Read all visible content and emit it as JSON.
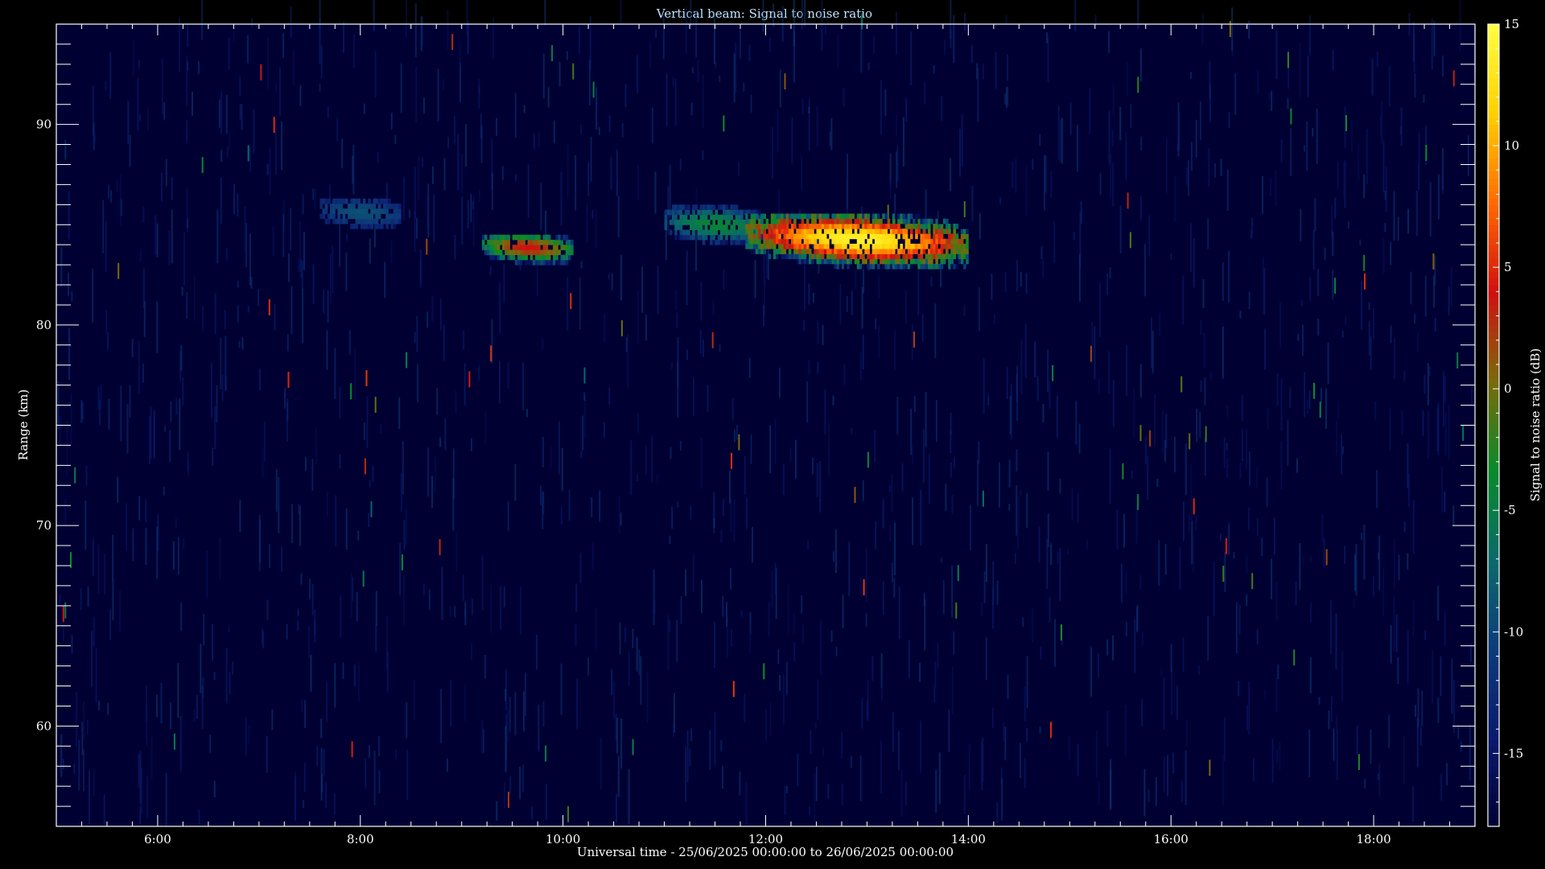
{
  "chart_data": {
    "type": "heatmap",
    "title": "Vertical beam: Signal to noise ratio",
    "xlabel": "Universal time - 25/06/2025 00:00:00 to 26/06/2025 00:00:00",
    "ylabel": "Range (km)",
    "colorbar_label": "Signal to noise ratio (dB)",
    "x_range_hours": [
      5.0,
      19.0
    ],
    "y_range_km": [
      55,
      95
    ],
    "x_ticks": [
      {
        "value": 6,
        "label": "6:00"
      },
      {
        "value": 8,
        "label": "8:00"
      },
      {
        "value": 10,
        "label": "10:00"
      },
      {
        "value": 12,
        "label": "12:00"
      },
      {
        "value": 14,
        "label": "14:00"
      },
      {
        "value": 16,
        "label": "16:00"
      },
      {
        "value": 18,
        "label": "18:00"
      }
    ],
    "y_ticks": [
      {
        "value": 60,
        "label": "60"
      },
      {
        "value": 70,
        "label": "70"
      },
      {
        "value": 80,
        "label": "80"
      },
      {
        "value": 90,
        "label": "90"
      }
    ],
    "colorbar_range_db": [
      -18,
      15
    ],
    "colorbar_ticks": [
      {
        "value": -15,
        "label": "-15"
      },
      {
        "value": -10,
        "label": "-10"
      },
      {
        "value": -5,
        "label": "-5"
      },
      {
        "value": 0,
        "label": "0"
      },
      {
        "value": 5,
        "label": "5"
      },
      {
        "value": 10,
        "label": "10"
      },
      {
        "value": 15,
        "label": "15"
      }
    ],
    "colormap": [
      "#000033",
      "#0a1a6e",
      "#0d3b7a",
      "#0a6a6a",
      "#0a8a2a",
      "#7a6a0a",
      "#d01010",
      "#ff6a00",
      "#ffd000",
      "#ffff40"
    ],
    "background_snr_db": -18,
    "echo_regions": [
      {
        "t_start": 7.6,
        "t_end": 8.4,
        "range_low": 84.8,
        "range_high": 86.2,
        "peak_snr_db": -9
      },
      {
        "t_start": 9.2,
        "t_end": 10.1,
        "range_low": 83.0,
        "range_high": 84.5,
        "peak_snr_db": 4
      },
      {
        "t_start": 11.0,
        "t_end": 12.0,
        "range_low": 84.0,
        "range_high": 85.8,
        "peak_snr_db": -4
      },
      {
        "t_start": 11.8,
        "t_end": 14.0,
        "range_low": 82.8,
        "range_high": 85.5,
        "peak_snr_db": 14
      }
    ]
  }
}
